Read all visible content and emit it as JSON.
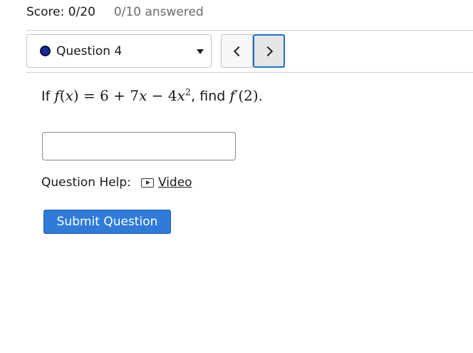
{
  "header": {
    "score": "Score: 0/20",
    "answered": "0/10 answered"
  },
  "question_nav": {
    "selected_label": "Question 4",
    "status_color": "#1a2a9c",
    "prev_icon": "chevron-left-icon",
    "next_icon": "chevron-right-icon"
  },
  "question": {
    "prefix": "If ",
    "func_f": "f",
    "func_arg": "(x)",
    "equals": " = ",
    "c0": "6",
    "plus": " + ",
    "c1": "7",
    "var1": "x",
    "minus": " − ",
    "c2": "4",
    "var2": "x",
    "exp": "2",
    "mid": ", find ",
    "deriv_f": "f",
    "prime": "′",
    "deriv_arg": "(2)",
    "suffix": "."
  },
  "answer": {
    "value": "",
    "placeholder": ""
  },
  "help": {
    "label": "Question Help:",
    "video_label": "Video",
    "video_icon": "play-icon"
  },
  "submit": {
    "label": "Submit Question",
    "color": "#2f7bd9"
  }
}
